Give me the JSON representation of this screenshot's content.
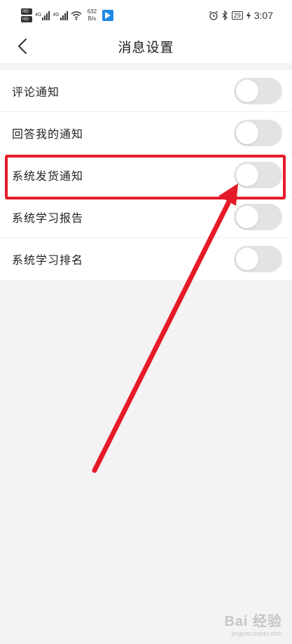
{
  "status_bar": {
    "hd_labels": [
      "HD",
      "HD"
    ],
    "network_labels": [
      "4G",
      "4G"
    ],
    "speed_value": "632",
    "speed_unit": "B/s",
    "battery": "29",
    "time": "3:07"
  },
  "header": {
    "title": "消息设置"
  },
  "settings": [
    {
      "label": "评论通知",
      "enabled": false
    },
    {
      "label": "回答我的通知",
      "enabled": false
    },
    {
      "label": "系统发货通知",
      "enabled": false
    },
    {
      "label": "系统学习报告",
      "enabled": false
    },
    {
      "label": "系统学习排名",
      "enabled": false
    }
  ],
  "annotation": {
    "color": "#e51b2a"
  },
  "watermark": {
    "logo": "Bai 经验",
    "url": "jingyan.baidu.com"
  }
}
